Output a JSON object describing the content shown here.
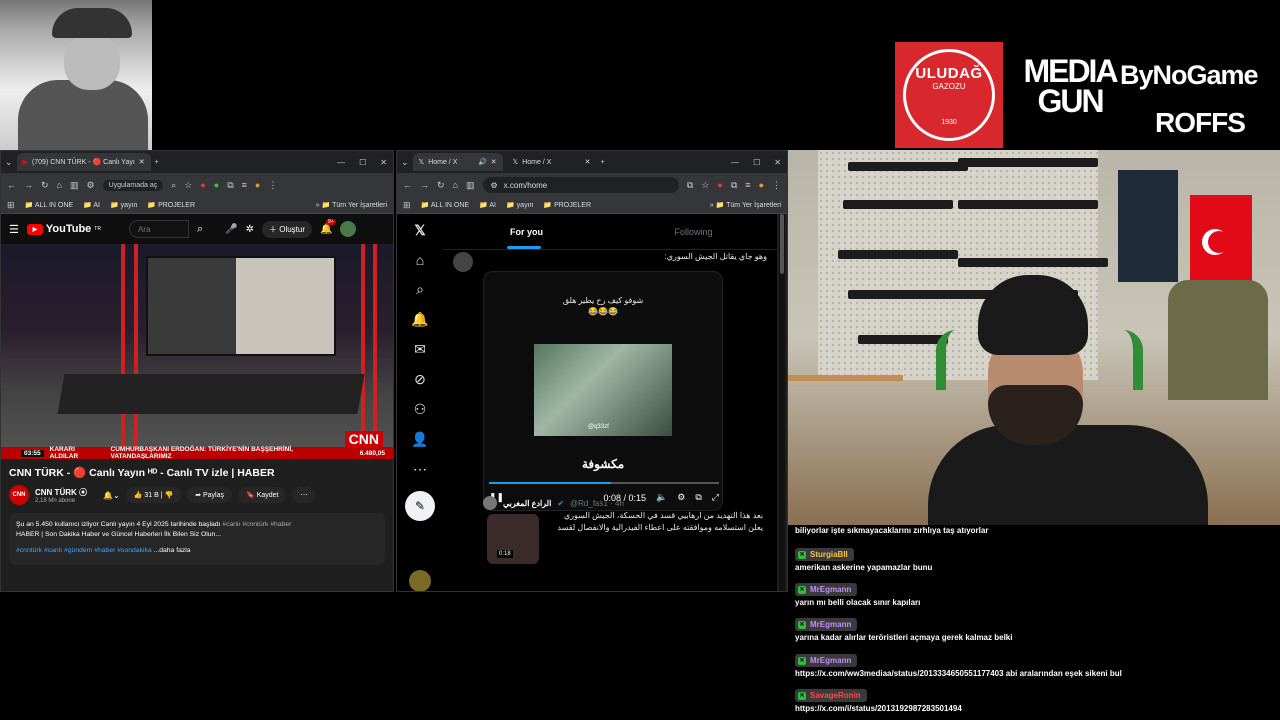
{
  "sponsors": {
    "uludag": {
      "name": "ULUDAĞ",
      "sub": "GAZOZU",
      "year": "1930"
    },
    "mediagun_line1": "MEDIA",
    "mediagun_line2": "GUN",
    "bynogame": "ByNoGame",
    "roffs": "ROFFS"
  },
  "youtube_window": {
    "tab_title": "(709) CNN TÜRK - 🔴 Canlı Yayı",
    "tab2_title": "+",
    "nav_pill": "Uygulamada aç",
    "bookmarks": [
      "ALL IN ONE",
      "AI",
      "yayın",
      "PROJELER"
    ],
    "bookmarks_right": "Tüm Yer İşaretleri",
    "search_placeholder": "Ara",
    "create_label": "Oluştur",
    "notif_count": "9+",
    "ticker_time": "03:55",
    "ticker_left": "KARARI ALDILAR",
    "ticker_text": "CUMHURBAŞKANI ERDOĞAN: TÜRKİYE'NİN BAŞŞEHRİNİ, VATANDAŞLARIMIZ",
    "ticker_num": "6.480,05",
    "cnn_badge": "CNN",
    "video_title": "CNN TÜRK - 🔴 Canlı Yayın ᴴᴰ - Canlı TV izle | HABER",
    "channel_name": "CNN TÜRK ⦿",
    "subscribers": "2,18 Mn abone",
    "likes": "31 B",
    "share": "Paylaş",
    "save": "Kaydet",
    "desc_line1": "Şu an 5.450 kullanıcı izliyor  Canlı yayın 4 Eyl 2025 tarihinde başladı",
    "desc_line1_tags": "#canlı #cnntürk #haber",
    "desc_line2": "HABER | Son Dakika Haber ve Güncel Haberleri İlk Bilen Siz Olun...",
    "desc_tags": "#cnntürk #canlı #gündem #haber #sondakika",
    "desc_more": "...daha fazla"
  },
  "x_window": {
    "tab1": "Home / X",
    "tab2": "Home / X",
    "url": "x.com/home",
    "bookmarks": [
      "ALL IN ONE",
      "AI",
      "yayın",
      "PROJELER"
    ],
    "bookmarks_right": "Tüm Yer İşaretleri",
    "tab_for_you": "For you",
    "tab_following": "Following",
    "tweet1_text": "وهو جاي يقاتل الجيش السوري:",
    "card_caption": "شوفو كيف رح يطير هلق",
    "card_emojis": "😂😂😂",
    "clip_watermark": "@q33zf",
    "card_logo": "مكشوفة",
    "video_time": "0:08 / 0:15",
    "video_progress": 0.53,
    "tweet2_author": "الرادع المغربي",
    "tweet2_handle": "@Rd_fas1 · 4h",
    "tweet2_body": "بعد هذا التهديد من ارهابيي قسد في الحسكة، الجيش السوري يعلن استسلامه وموافقته على اعطاء الفيدرالية والانفصال لقسد",
    "tweet2_thumb_time": "0:18"
  },
  "chat": {
    "messages": [
      {
        "user": "",
        "text": "biliyorlar işte sıkmayacaklarını zırhlıya taş atıyorlar",
        "color": "#2fbd3a"
      },
      {
        "user": "SturgiaBII",
        "text": "amerikan askerine yapamazlar bunu",
        "color": "#f5c242"
      },
      {
        "user": "MrEgmann",
        "text": "yarın mı belli olacak sınır kapıları",
        "color": "#c58cff"
      },
      {
        "user": "MrEgmann",
        "text": "yarına kadar alırlar teröristleri açmaya gerek kalmaz belki",
        "color": "#c58cff"
      },
      {
        "user": "MrEgmann",
        "text": "https://x.com/ww3mediaa/status/2013334650551177403 abi aralarından eşek sikeni bul",
        "color": "#c58cff"
      },
      {
        "user": "SavageRonin",
        "text": "https://x.com/i/status/2013192987283501494",
        "color": "#ff4a4a"
      }
    ]
  },
  "colors": {
    "accent": "#1d9bf0",
    "yt_red": "#ff0000",
    "uludag_red": "#d8282e",
    "twitch_green": "#2fbd3a"
  }
}
